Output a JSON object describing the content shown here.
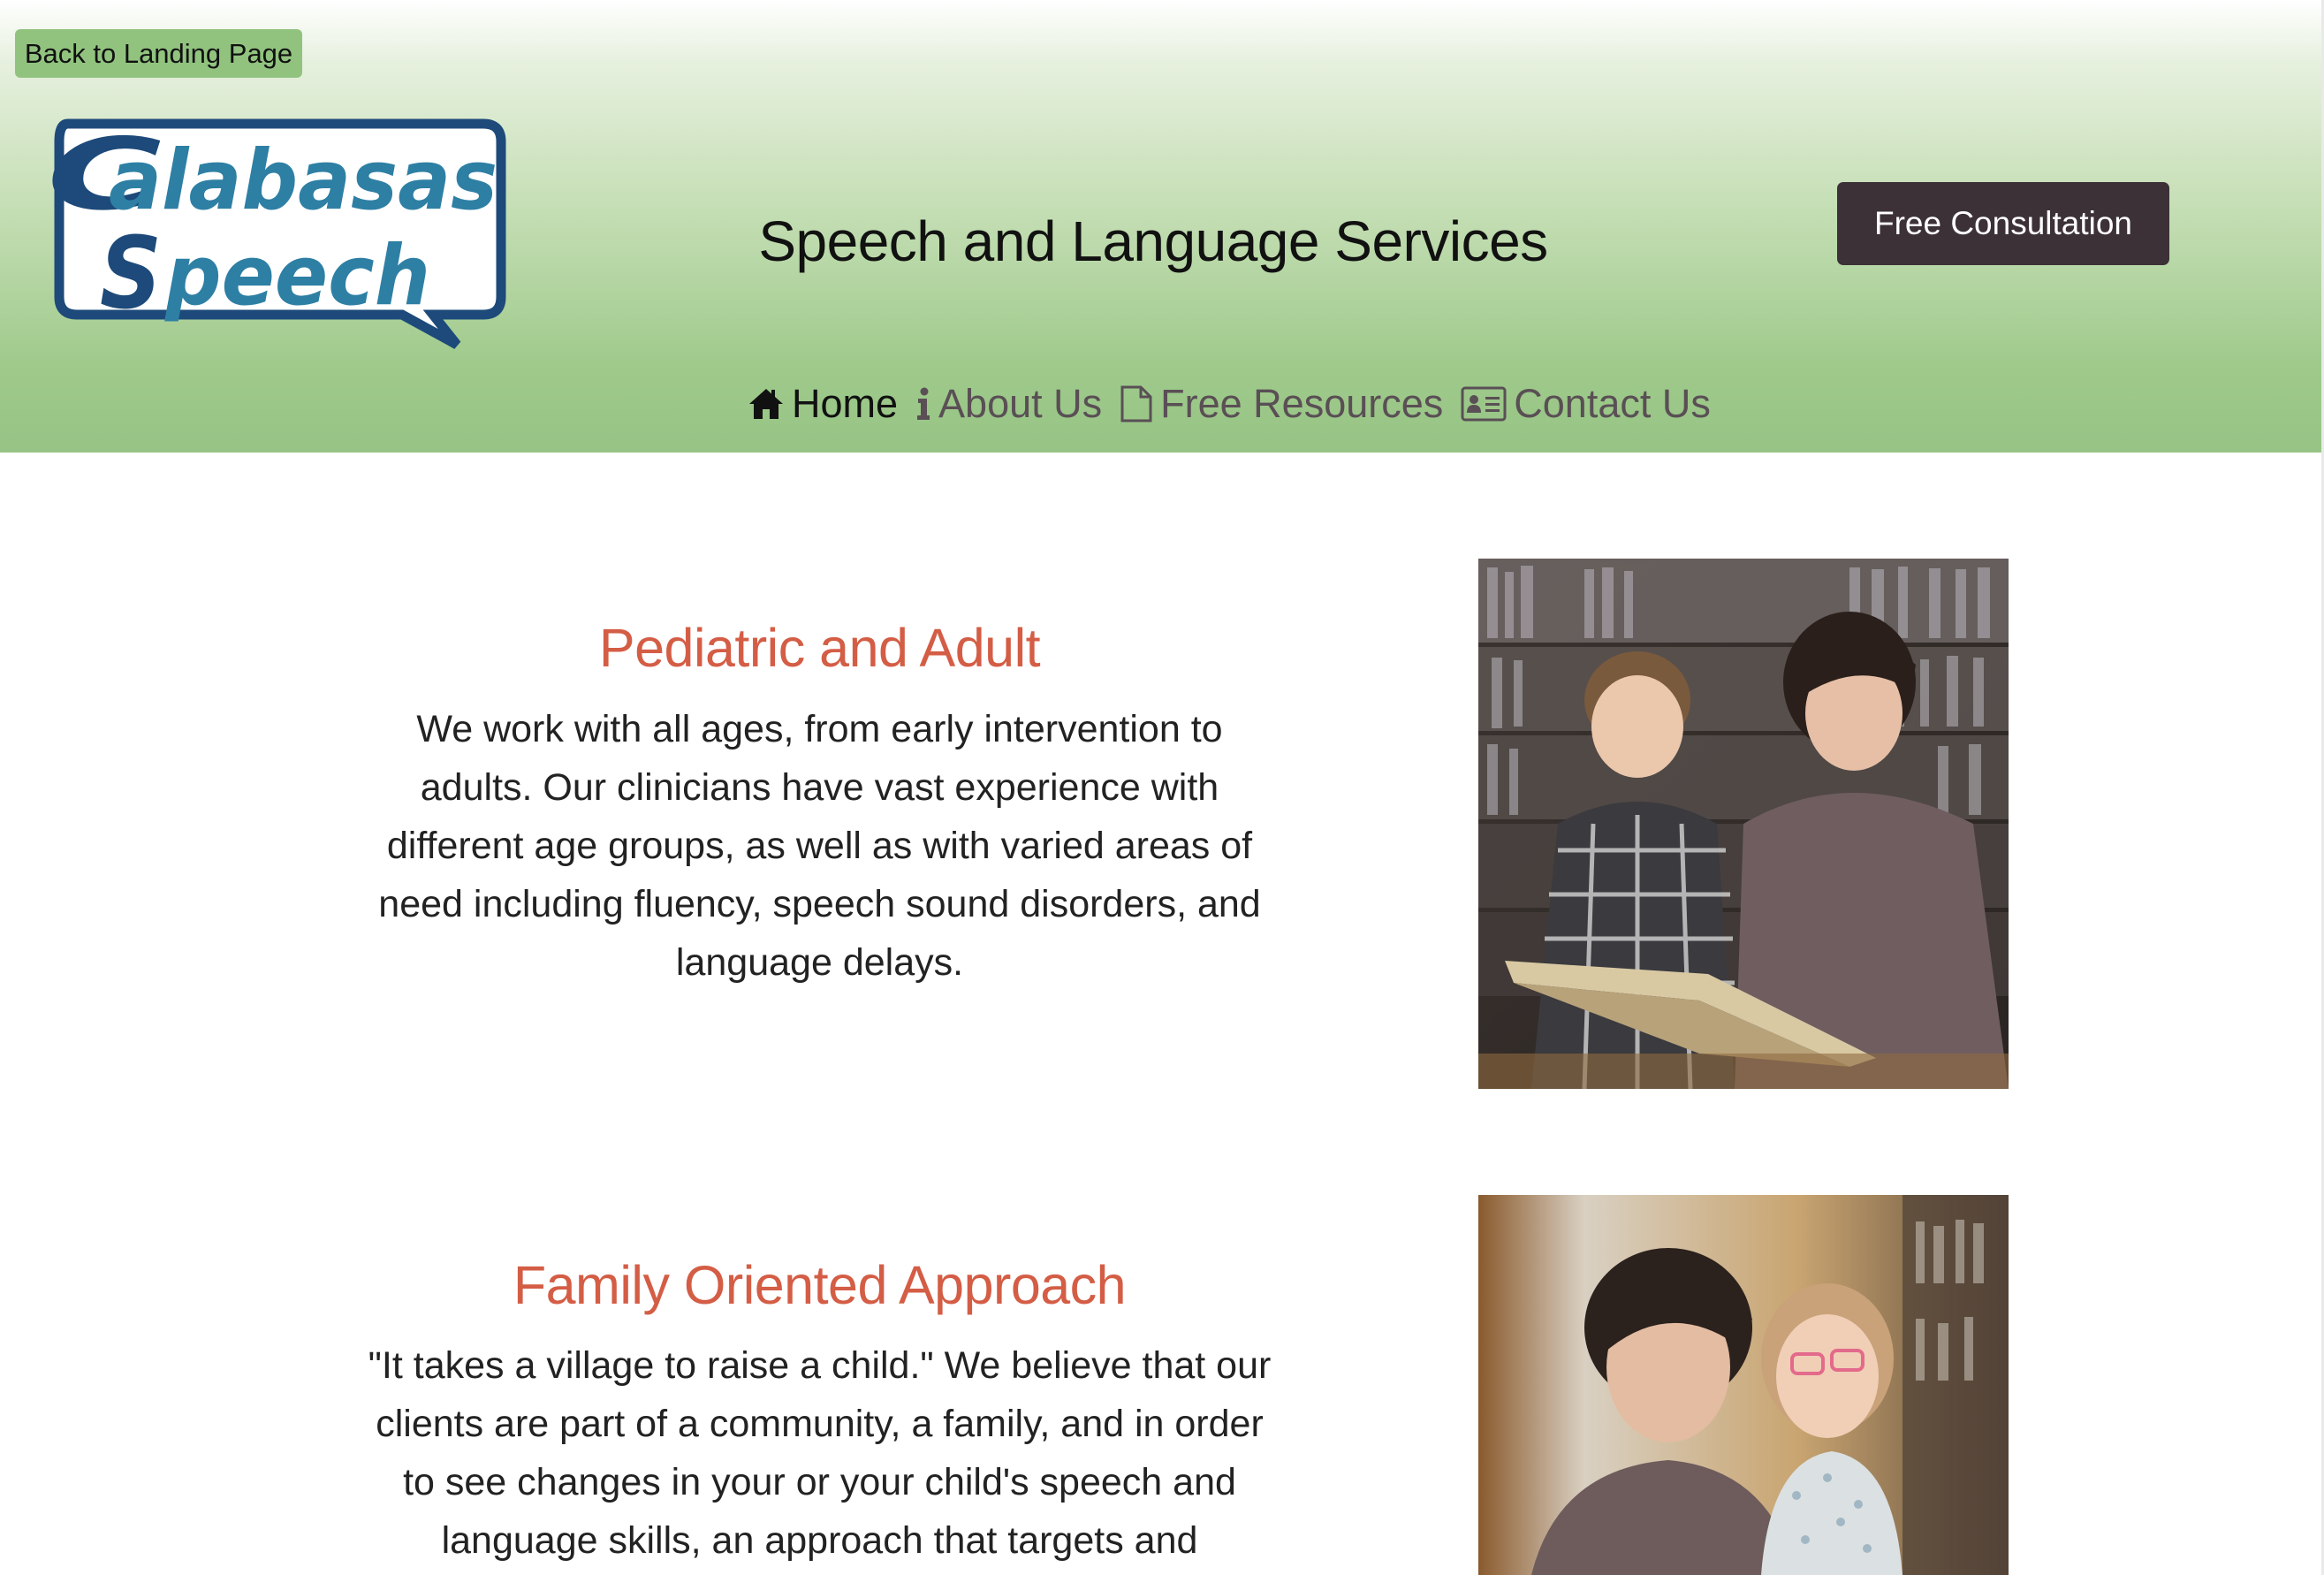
{
  "header": {
    "back_label": "Back to Landing Page",
    "logo_line1": "Calabasas",
    "logo_line2": "Speech",
    "site_title": "Speech and Language Services",
    "cta_label": "Free Consultation",
    "colors": {
      "header_green": "#97c486",
      "cta_dark": "#3c3137",
      "logo_blue": "#1d4a7a"
    }
  },
  "nav": {
    "items": [
      {
        "label": "Home",
        "icon": "home-icon",
        "active": true
      },
      {
        "label": "About Us",
        "icon": "info-icon",
        "active": false
      },
      {
        "label": "Free Resources",
        "icon": "document-icon",
        "active": false
      },
      {
        "label": "Contact Us",
        "icon": "contact-card-icon",
        "active": false
      }
    ]
  },
  "sections": [
    {
      "heading": "Pediatric and Adult",
      "lines": [
        "We work with all ages, from early intervention to",
        "adults. Our clinicians have vast experience with",
        "different age groups, as well as with varied areas of",
        "need including fluency, speech sound disorders, and",
        "language delays."
      ],
      "image": "photo-woman-reading-with-boy"
    },
    {
      "heading": "Family Oriented Approach",
      "lines": [
        "\"It takes a village to raise a child.\" We believe that our",
        "clients are part of a community, a family, and in order",
        "to see changes in your or your child's speech and",
        "language skills, an approach that targets and"
      ],
      "image": "photo-woman-with-girl"
    }
  ],
  "accent_color": "#d45d45"
}
